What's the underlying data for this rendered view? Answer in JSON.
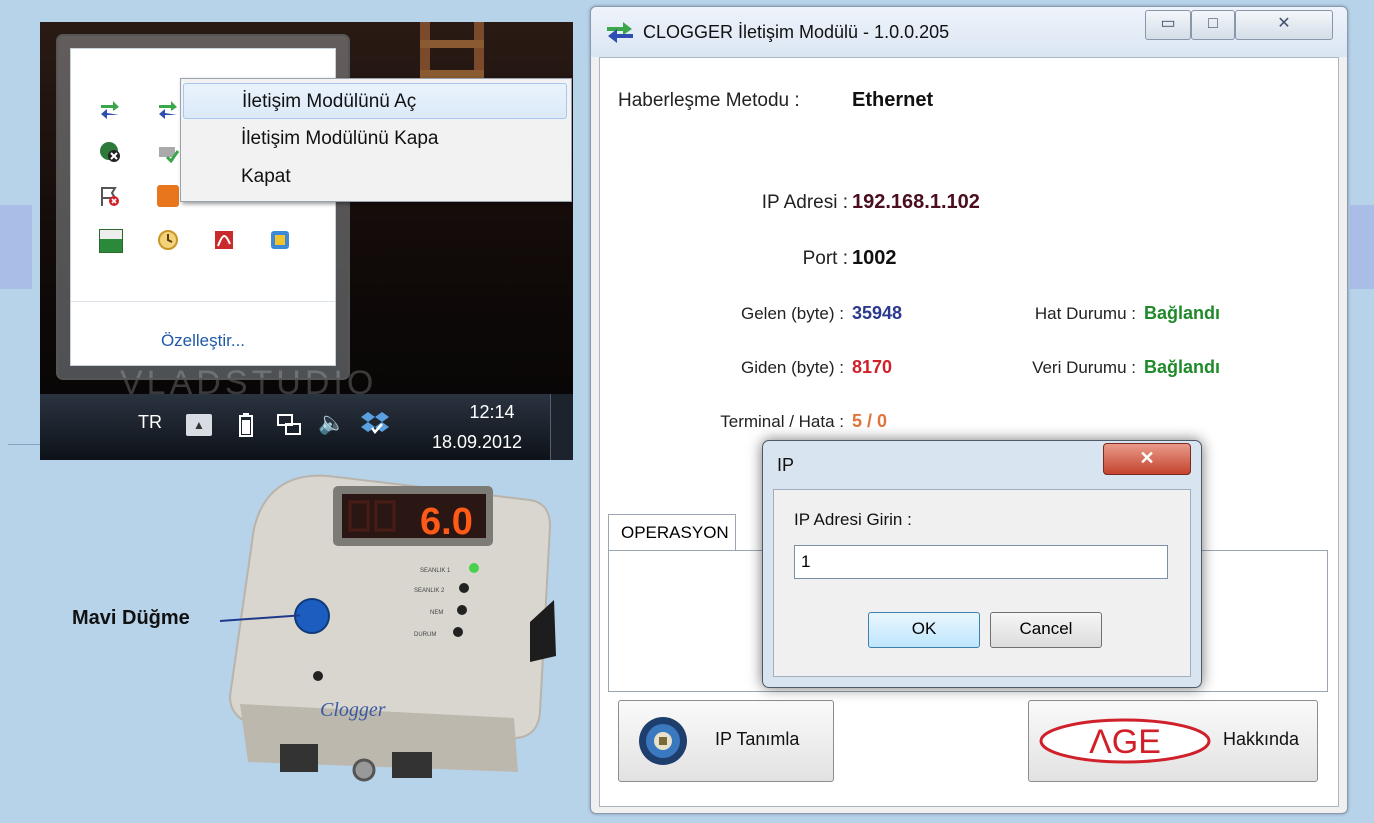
{
  "tray": {
    "customize_link": "Özelleştir...",
    "watermark": "VLADSTUDIO",
    "context_menu": {
      "items": [
        "İletişim Modülünü Aç",
        "İletişim Modülünü Kapa",
        "Kapat"
      ]
    },
    "taskbar": {
      "language": "TR",
      "time": "12:14",
      "date": "18.09.2012"
    }
  },
  "window": {
    "title": "CLOGGER İletişim Modülü - 1.0.0.205",
    "minimize_glyph": "▭",
    "maximize_glyph": "□",
    "close_glyph": "✕",
    "method_label": "Haberleşme Metodu :",
    "method_value": "Ethernet",
    "ip_label": "IP Adresi :",
    "ip_value": "192.168.1.102",
    "port_label": "Port :",
    "port_value": "1002",
    "received_label": "Gelen (byte) :",
    "received_value": "35948",
    "sent_label": "Giden (byte) :",
    "sent_value": "8170",
    "line_status_label": "Hat Durumu :",
    "line_status_value": "Bağlandı",
    "data_status_label": "Veri Durumu :",
    "data_status_value": "Bağlandı",
    "terminal_label": "Terminal / Hata :",
    "terminal_value": "5 / 0",
    "tab_label": "OPERASYON",
    "ip_button_label": "IP Tanımla",
    "about_button_label": "Hakkında",
    "age_logo_text": "ΛGE"
  },
  "dialog": {
    "title": "IP",
    "close_glyph": "✕",
    "prompt": "IP Adresi Girin :",
    "input_value": "1",
    "ok_label": "OK",
    "cancel_label": "Cancel"
  },
  "device": {
    "annotation": "Mavi Düğme",
    "display_value": "6.0",
    "brand": "Clogger",
    "leds": [
      "SEANLIK 1",
      "SEANLIK 2",
      "NEM",
      "DURUM"
    ]
  },
  "colors": {
    "blue_value": "#2b3a8f",
    "red_value": "#d0202a",
    "green_value": "#1f8a2a",
    "orange_value": "#e0743a",
    "maroon_value": "#4a0e1e",
    "background": "#b7d3ea"
  }
}
